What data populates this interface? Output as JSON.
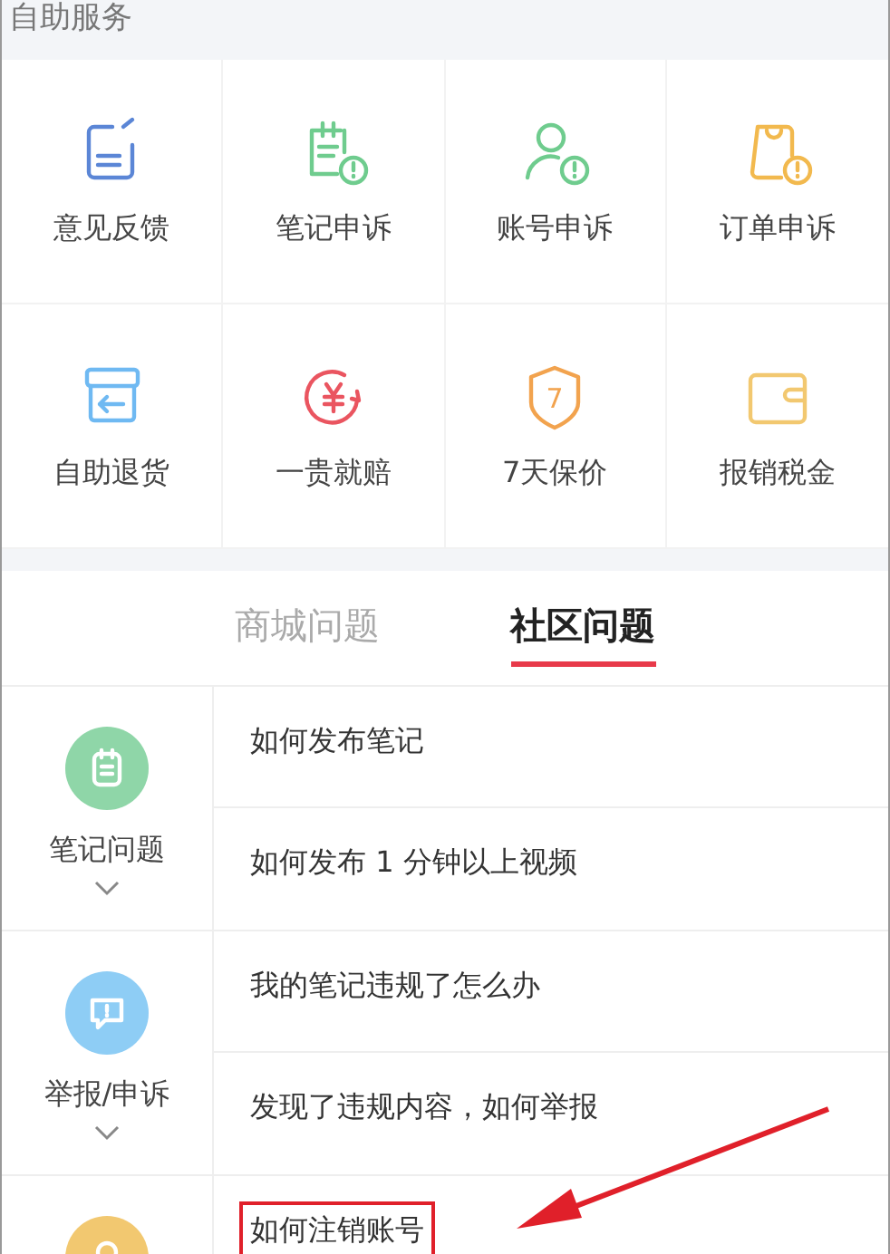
{
  "section_title": "自助服务",
  "services": [
    {
      "label": "意见反馈",
      "kind": "feedback"
    },
    {
      "label": "笔记申诉",
      "kind": "note-appeal"
    },
    {
      "label": "账号申诉",
      "kind": "account-appeal"
    },
    {
      "label": "订单申诉",
      "kind": "order-appeal"
    },
    {
      "label": "自助退货",
      "kind": "return"
    },
    {
      "label": "一贵就赔",
      "kind": "compensation"
    },
    {
      "label": "7天保价",
      "kind": "price-protect",
      "badge": "7"
    },
    {
      "label": "报销税金",
      "kind": "wallet"
    }
  ],
  "tabs": [
    {
      "label": "商城问题",
      "selected": false
    },
    {
      "label": "社区问题",
      "selected": true
    }
  ],
  "categories": [
    {
      "label": "笔记问题",
      "color": "#8fd6a8",
      "kind": "note",
      "questions": [
        {
          "text": "如何发布笔记",
          "highlighted": false
        },
        {
          "text": "如何发布 1 分钟以上视频",
          "highlighted": false
        }
      ]
    },
    {
      "label": "举报/申诉",
      "color": "#8ecdf5",
      "kind": "report",
      "questions": [
        {
          "text": "我的笔记违规了怎么办",
          "highlighted": false
        },
        {
          "text": "发现了违规内容，如何举报",
          "highlighted": false
        }
      ]
    },
    {
      "color": "#f2c870",
      "kind": "account",
      "questions": [
        {
          "text": "如何注销账号",
          "highlighted": true
        }
      ]
    }
  ]
}
